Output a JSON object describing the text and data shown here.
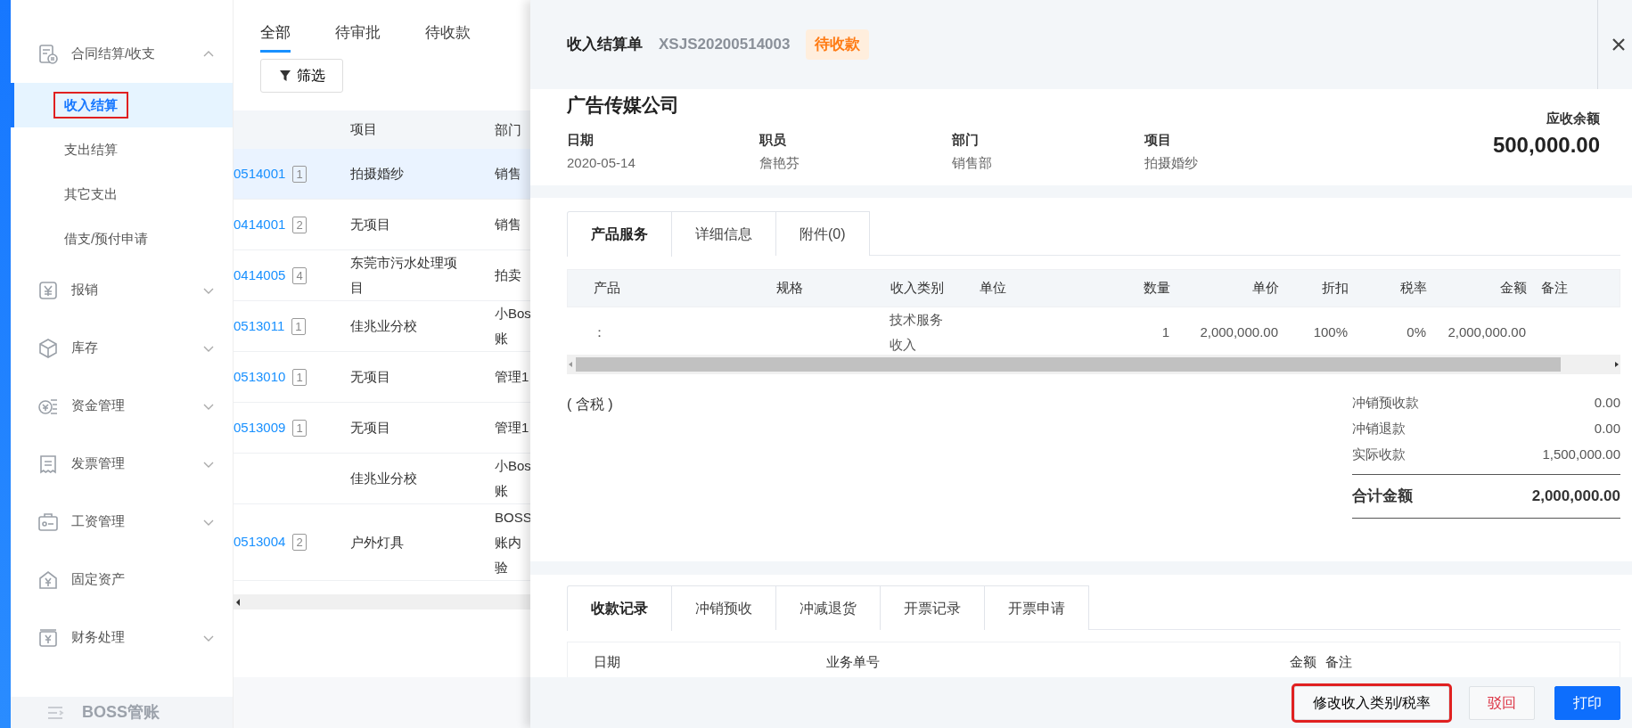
{
  "sidebar": {
    "items": [
      {
        "kind": "group",
        "label": "合同结算/收支",
        "expanded": true,
        "children": [
          {
            "label": "收入结算",
            "selected": true,
            "highlighted": true
          },
          {
            "label": "支出结算",
            "selected": false,
            "highlighted": false
          },
          {
            "label": "其它支出",
            "selected": false,
            "highlighted": false
          },
          {
            "label": "借支/预付申请",
            "selected": false,
            "highlighted": false
          }
        ]
      },
      {
        "kind": "group",
        "label": "报销",
        "expanded": false
      },
      {
        "kind": "group",
        "label": "库存",
        "expanded": false
      },
      {
        "kind": "group",
        "label": "资金管理",
        "expanded": false
      },
      {
        "kind": "group",
        "label": "发票管理",
        "expanded": false
      },
      {
        "kind": "group",
        "label": "工资管理",
        "expanded": false
      },
      {
        "kind": "link",
        "label": "固定资产"
      },
      {
        "kind": "group",
        "label": "财务处理",
        "expanded": false
      }
    ],
    "footer": "BOSS管账"
  },
  "list": {
    "tabs": [
      {
        "label": "全部",
        "selected": true
      },
      {
        "label": "待审批",
        "selected": false
      },
      {
        "label": "待收款",
        "selected": false
      }
    ],
    "filter_button": "筛选",
    "columns": [
      "项目",
      "部门"
    ],
    "rows": [
      {
        "number": "0514001",
        "count": "1",
        "project": "拍摄婚纱",
        "department": [
          "销售"
        ],
        "selected": true
      },
      {
        "number": "0414001",
        "count": "2",
        "project": "无项目",
        "department": [
          "销售"
        ],
        "selected": false
      },
      {
        "number": "0414005",
        "count": "4",
        "project": "东莞市污水处理项目",
        "department": [
          "拍卖"
        ],
        "selected": false
      },
      {
        "number": "0513011",
        "count": "1",
        "project": "佳兆业分校",
        "department": [
          "小Bos",
          "账"
        ],
        "selected": false
      },
      {
        "number": "0513010",
        "count": "1",
        "project": "无项目",
        "department": [
          "管理1"
        ],
        "selected": false
      },
      {
        "number": "0513009",
        "count": "1",
        "project": "无项目",
        "department": [
          "管理1"
        ],
        "selected": false
      },
      {
        "project": "佳兆业分校",
        "department": [
          "小Bos",
          "账"
        ],
        "selected": false
      },
      {
        "number": "0513004",
        "count": "2",
        "project": "户外灯具",
        "department": [
          "BOSS",
          "账内",
          "验"
        ],
        "selected": false
      }
    ]
  },
  "panel": {
    "title": "收入结算单",
    "number": "XSJS20200514003",
    "status": "待收款",
    "company": "广告传媒公司",
    "fields": [
      {
        "label": "日期",
        "value": "2020-05-14"
      },
      {
        "label": "职员",
        "value": "詹艳芬"
      },
      {
        "label": "部门",
        "value": "销售部"
      },
      {
        "label": "项目",
        "value": "拍摄婚纱"
      }
    ],
    "balance": {
      "label": "应收余额",
      "value": "500,000.00"
    },
    "detail_tabs": [
      {
        "label": "产品服务",
        "selected": true
      },
      {
        "label": "详细信息",
        "selected": false
      },
      {
        "label": "附件(0)",
        "selected": false
      }
    ],
    "items_table": {
      "columns": [
        "产品",
        "规格",
        "收入类别",
        "单位",
        "数量",
        "单价",
        "折扣",
        "税率",
        "金额",
        "备注"
      ],
      "rows": [
        [
          "：",
          null,
          "技术服务收入",
          null,
          "1",
          "2,000,000.00",
          "100%",
          "0%",
          "2,000,000.00",
          null
        ]
      ]
    },
    "tax_note": "( 含税 )",
    "summary": [
      {
        "label": "冲销预收款",
        "value": "0.00"
      },
      {
        "label": "冲销退款",
        "value": "0.00"
      },
      {
        "label": "实际收款",
        "value": "1,500,000.00"
      }
    ],
    "total": {
      "label": "合计金额",
      "value": "2,000,000.00"
    },
    "record_tabs": [
      {
        "label": "收款记录",
        "selected": true
      },
      {
        "label": "冲销预收",
        "selected": false
      },
      {
        "label": "冲减退货",
        "selected": false
      },
      {
        "label": "开票记录",
        "selected": false
      },
      {
        "label": "开票申请",
        "selected": false
      }
    ],
    "record_columns": [
      "日期",
      "业务单号",
      "金额",
      "备注"
    ],
    "buttons": [
      {
        "label": "修改收入类别/税率",
        "kind": "default",
        "highlighted": true
      },
      {
        "label": "驳回",
        "kind": "danger",
        "highlighted": false
      },
      {
        "label": "打印",
        "kind": "primary",
        "highlighted": false
      }
    ]
  }
}
